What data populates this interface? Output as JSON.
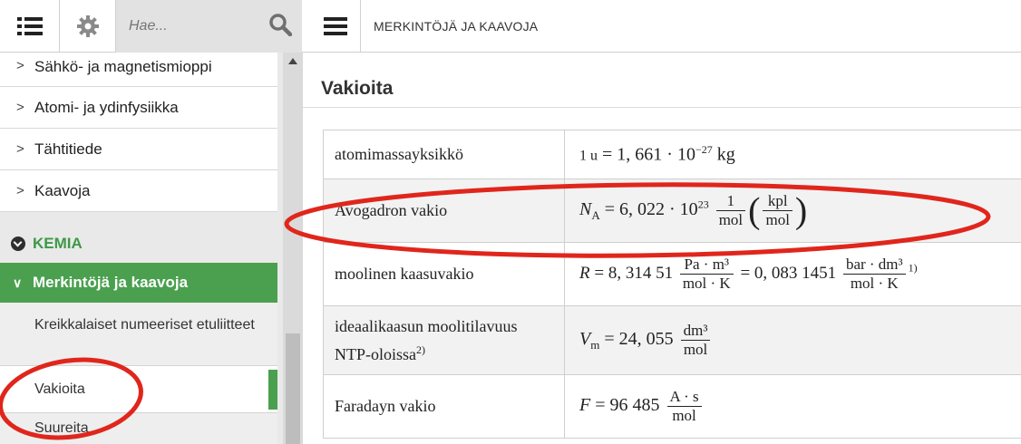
{
  "topbar": {
    "search_placeholder": "Hae...",
    "breadcrumb": "MERKINTÖJÄ JA KAAVOJA",
    "icons": [
      "list-menu-icon",
      "gear-icon",
      "search-icon",
      "hamburger-menu-icon"
    ]
  },
  "sidebar": {
    "items": [
      {
        "label": "Sähkö- ja magnetismioppi"
      },
      {
        "label": "Atomi- ja ydinfysiikka"
      },
      {
        "label": "Tähtitiede"
      },
      {
        "label": "Kaavoja"
      }
    ],
    "section": "KEMIA",
    "active_item": "Merkintöjä ja kaavoja",
    "subitems": [
      {
        "label": "Kreikkalaiset numeeriset etuliitteet"
      },
      {
        "label": "Vakioita"
      },
      {
        "label": "Suureita"
      }
    ]
  },
  "content": {
    "heading": "Vakioita",
    "rows": [
      {
        "name": "atomimassayksikkö",
        "formula": {
          "lhs": "1 u",
          "value": "1, 661 · 10",
          "exp": "−27",
          "unit": "kg"
        }
      },
      {
        "name": "Avogadron vakio",
        "formula": {
          "sym": "N",
          "sub": "A",
          "value": "= 6, 022 · 10",
          "exp": "23",
          "f1_num": "1",
          "f1_den": "mol",
          "f2_num": "kpl",
          "f2_den": "mol"
        }
      },
      {
        "name": "moolinen kaasuvakio",
        "formula": {
          "sym": "R",
          "value": "= 8, 314 51",
          "f1_num": "Pa · m³",
          "f1_den": "mol · K",
          "value2": "= 0, 083 1451",
          "f2_num": "bar · dm³",
          "f2_den": "mol · K",
          "note": "1)"
        }
      },
      {
        "name": "ideaalikaasun moolitilavuus",
        "name2": "NTP-oloissa",
        "name_note": "2)",
        "formula": {
          "sym": "V",
          "sub": "m",
          "value": "= 24, 055",
          "f_num": "dm³",
          "f_den": "mol"
        }
      },
      {
        "name": "Faradayn vakio",
        "formula": {
          "sym": "F",
          "value": "= 96 485",
          "f_num": "A · s",
          "f_den": "mol"
        }
      }
    ]
  },
  "annotation_color": "#e0261c",
  "accent_color": "#4aa04e"
}
